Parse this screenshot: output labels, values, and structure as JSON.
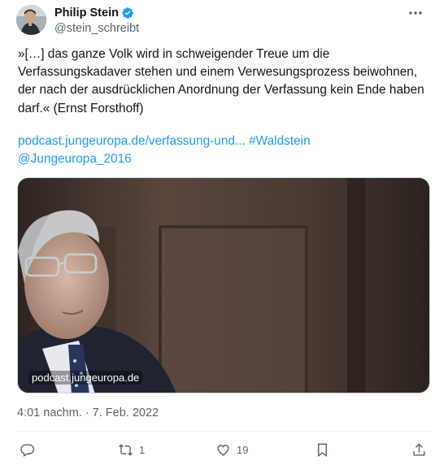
{
  "author": {
    "name": "Philip Stein",
    "handle": "@stein_schreibt"
  },
  "tweet": {
    "text": "»[…] das ganze Volk wird in schweigender Treue um die Verfassungskadaver stehen und einem Verwesungsprozess beiwohnen, der nach der ausdrücklichen Anordnung der Verfassung kein Ende haben darf.« (Ernst Forsthoff)",
    "link_url": "podcast.jungeuropa.de/verfassung-und...",
    "hashtag": "#Waldstein",
    "mention": "@Jungeuropa_2016"
  },
  "media": {
    "domain": "podcast.jungeuropa.de"
  },
  "timestamp": "4:01 nachm. · 7. Feb. 2022",
  "actions": {
    "retweets": "1",
    "likes": "19"
  },
  "colors": {
    "link": "#1d9bf0",
    "secondary_text": "#536471",
    "verified": "#1d9bf0"
  }
}
